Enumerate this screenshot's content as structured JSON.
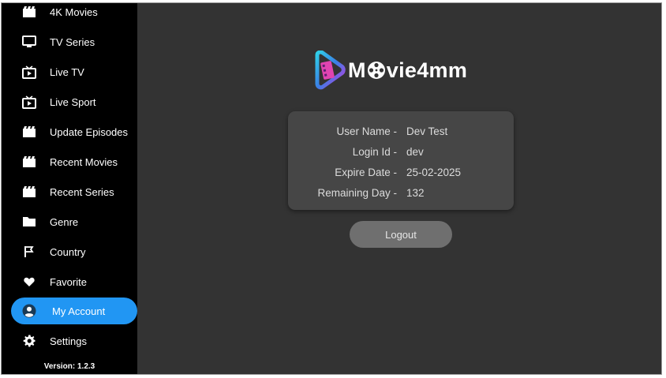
{
  "sidebar": {
    "items": [
      {
        "label": "4K Movies",
        "icon": "movie-clapper-icon"
      },
      {
        "label": "TV Series",
        "icon": "tv-icon"
      },
      {
        "label": "Live TV",
        "icon": "live-tv-icon"
      },
      {
        "label": "Live Sport",
        "icon": "live-tv-icon"
      },
      {
        "label": "Update Episodes",
        "icon": "movie-clapper-icon"
      },
      {
        "label": "Recent Movies",
        "icon": "movie-clapper-icon"
      },
      {
        "label": "Recent Series",
        "icon": "movie-clapper-icon"
      },
      {
        "label": "Genre",
        "icon": "folder-icon"
      },
      {
        "label": "Country",
        "icon": "flag-icon"
      },
      {
        "label": "Favorite",
        "icon": "heart-icon"
      },
      {
        "label": "My Account",
        "icon": "account-circle-icon",
        "active": true
      },
      {
        "label": "Settings",
        "icon": "gear-icon"
      }
    ],
    "version": "Version: 1.2.3"
  },
  "logo": {
    "text_before": "M",
    "text_after": "vie4mm"
  },
  "account": {
    "user_name_label": "User Name -",
    "user_name": "Dev Test",
    "login_id_label": "Login Id -",
    "login_id": "dev",
    "expire_date_label": "Expire Date -",
    "expire_date": "25-02-2025",
    "remaining_day_label": "Remaining Day -",
    "remaining_day": "132"
  },
  "logout_label": "Logout",
  "colors": {
    "accent": "#2196f3",
    "sidebar_bg": "#000000",
    "main_bg": "#333333",
    "card_bg": "#464646",
    "button_bg": "#6f6f6f"
  }
}
